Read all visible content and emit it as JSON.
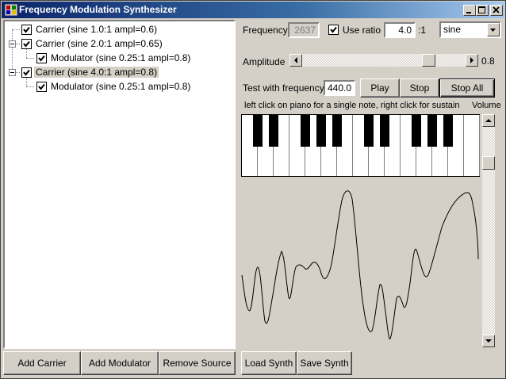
{
  "window": {
    "title": "Frequency Modulation Synthesizer"
  },
  "tree": {
    "nodes": [
      {
        "label": "Carrier (sine 1.0:1 ampl=0.6)",
        "checked": true,
        "selected": false
      },
      {
        "label": "Carrier (sine 2.0:1 ampl=0.65)",
        "checked": true,
        "selected": false
      },
      {
        "label": "Modulator (sine 0.25:1 ampl=0.8)",
        "checked": true,
        "selected": false
      },
      {
        "label": "Carrier (sine 4.0:1 ampl=0.8)",
        "checked": true,
        "selected": true
      },
      {
        "label": "Modulator (sine 0.25:1 ampl=0.8)",
        "checked": true,
        "selected": false
      }
    ]
  },
  "source_buttons": {
    "add_carrier": "Add Carrier",
    "add_modulator": "Add Modulator",
    "remove_source": "Remove Source"
  },
  "synth_buttons": {
    "load": "Load Synth",
    "save": "Save Synth"
  },
  "frequency": {
    "label": "Frequency",
    "value": "2637",
    "use_ratio_label": "Use ratio",
    "use_ratio_checked": true,
    "ratio_value": "4.0",
    "ratio_suffix": ":1"
  },
  "waveform": {
    "selected": "sine"
  },
  "amplitude": {
    "label": "Amplitude",
    "value_text": "0.8",
    "level": 0.8
  },
  "test": {
    "label": "Test with frequency",
    "value": "440.0",
    "play": "Play",
    "stop": "Stop",
    "stop_all": "Stop All"
  },
  "piano": {
    "hint": "left click on piano for a single note, right click for sustain",
    "white_keys": 15
  },
  "volume": {
    "label": "Volume",
    "level": 0.85
  },
  "icons": {
    "app": "app-icon",
    "minimize": "minimize-icon",
    "maximize": "maximize-icon",
    "close": "close-icon",
    "checkbox": "checkmark-icon",
    "combo_arrow": "chevron-down-icon",
    "scroll_left": "arrow-left-icon",
    "scroll_right": "arrow-right-icon",
    "scroll_up": "arrow-up-icon",
    "scroll_down": "arrow-down-icon"
  },
  "colors": {
    "titlebar_start": "#0a246a",
    "titlebar_end": "#a6caf0",
    "face": "#d4d0c8"
  }
}
